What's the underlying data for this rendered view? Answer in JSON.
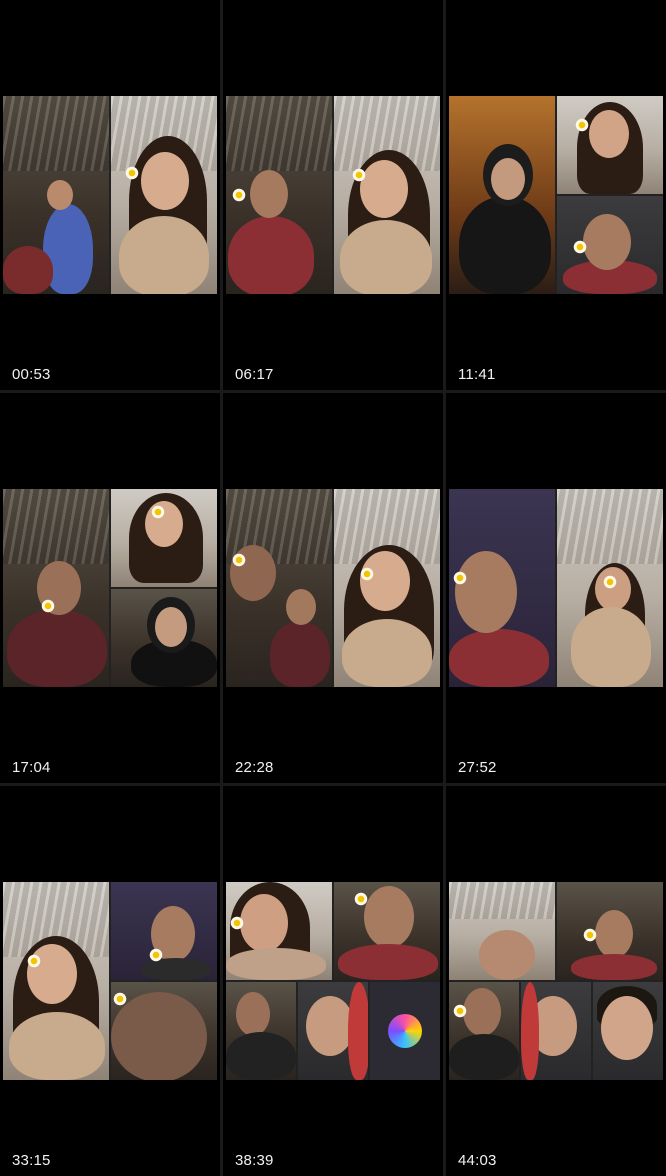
{
  "thumbnails": [
    {
      "duration": "00:53"
    },
    {
      "duration": "06:17"
    },
    {
      "duration": "11:41"
    },
    {
      "duration": "17:04"
    },
    {
      "duration": "22:28"
    },
    {
      "duration": "27:52"
    },
    {
      "duration": "33:15"
    },
    {
      "duration": "38:39"
    },
    {
      "duration": "44:03"
    }
  ]
}
